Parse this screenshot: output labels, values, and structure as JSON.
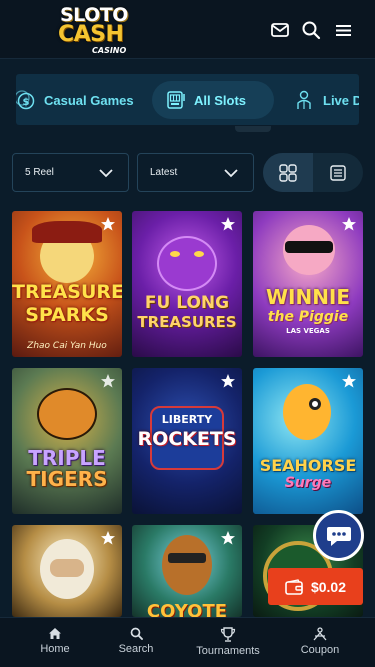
{
  "header": {
    "logo_line1": "SLOTO",
    "logo_line2": "CASH",
    "logo_line3": "CASINO",
    "icons": [
      "mail-icon",
      "search-icon",
      "menu-icon"
    ]
  },
  "categories": [
    {
      "label": "Casual Games",
      "icon": "dollar-coin-icon"
    },
    {
      "label": "All Slots",
      "icon": "slot-machine-icon",
      "active": true
    },
    {
      "label": "Live D",
      "icon": "dealer-icon"
    }
  ],
  "filters": {
    "reel": "5 Reel",
    "sort": "Latest"
  },
  "games": [
    {
      "title_line1": "TREASURE",
      "title_line2": "SPARKS",
      "subtitle": "Zhao Cai Yan Huo"
    },
    {
      "title_line1": "FU LONG",
      "title_line2": "TREASURES",
      "subtitle": ""
    },
    {
      "title_line1": "WINNIE",
      "title_line2": "the Piggie",
      "subtitle": "LAS VEGAS"
    },
    {
      "title_line1": "TRIPLE",
      "title_line2": "TIGERS",
      "subtitle": ""
    },
    {
      "title_line1": "LIBERTY",
      "title_line2": "ROCKETS",
      "subtitle": ""
    },
    {
      "title_line1": "SEAHORSE",
      "title_line2": "Surge",
      "subtitle": ""
    },
    {
      "title_line1": "",
      "title_line2": "",
      "subtitle": ""
    },
    {
      "title_line1": "COYOTE",
      "title_line2": "",
      "subtitle": ""
    },
    {
      "title_line1": "",
      "title_line2": "",
      "subtitle": ""
    }
  ],
  "balance": "$0.02",
  "bottom_nav": [
    {
      "label": "Home",
      "icon": "home-icon"
    },
    {
      "label": "Search",
      "icon": "search-icon"
    },
    {
      "label": "Tournaments",
      "icon": "trophy-icon"
    },
    {
      "label": "Coupon",
      "icon": "coupon-icon"
    }
  ],
  "colors": {
    "background": "#0b1c2a",
    "accent_cyan": "#6ee0f0",
    "balance_orange": "#e8401c",
    "chat_blue": "#1f3e8c"
  }
}
